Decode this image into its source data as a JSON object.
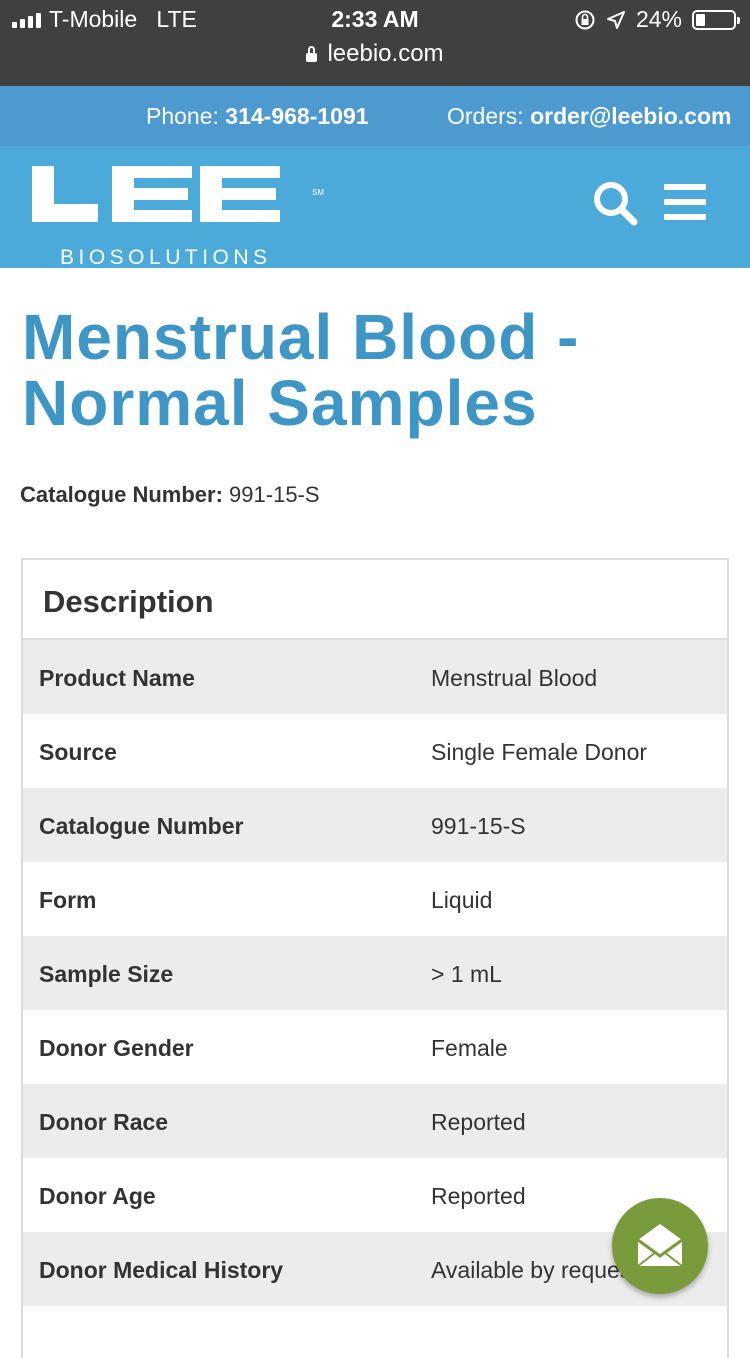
{
  "status_bar": {
    "carrier": "T-Mobile",
    "network": "LTE",
    "time": "2:33 AM",
    "battery": "24%",
    "battery_level": 0.24,
    "url": "leebio.com"
  },
  "contact_bar": {
    "phone_label": "Phone:",
    "phone_value": "314-968-1091",
    "orders_label": "Orders:",
    "orders_value": "order@leebio.com"
  },
  "header": {
    "logo_main": "LEE",
    "logo_sub": "BIOSOLUTIONS",
    "logo_mark": "SM",
    "icons": [
      "search-icon",
      "hamburger-menu-icon"
    ]
  },
  "page": {
    "title": "Menstrual Blood - Normal Samples",
    "catalogue_label": "Catalogue Number:",
    "catalogue_value": "991-15-S"
  },
  "description": {
    "heading": "Description",
    "rows": [
      {
        "label": "Product Name",
        "value": "Menstrual Blood"
      },
      {
        "label": "Source",
        "value": "Single Female Donor"
      },
      {
        "label": "Catalogue Number",
        "value": "991-15-S"
      },
      {
        "label": "Form",
        "value": "Liquid"
      },
      {
        "label": "Sample Size",
        "value": "> 1 mL"
      },
      {
        "label": "Donor Gender",
        "value": "Female"
      },
      {
        "label": "Donor Race",
        "value": "Reported"
      },
      {
        "label": "Donor Age",
        "value": "Reported"
      },
      {
        "label": "Donor Medical History",
        "value": "Available by request"
      }
    ]
  },
  "fab": {
    "icon": "envelope-open-icon"
  },
  "colors": {
    "status_bar_bg": "#404040",
    "contact_bar_bg": "#4d9ad1",
    "header_bg": "#4baad9",
    "title": "#3d96c5",
    "fab_bg": "#7a9b3b"
  }
}
